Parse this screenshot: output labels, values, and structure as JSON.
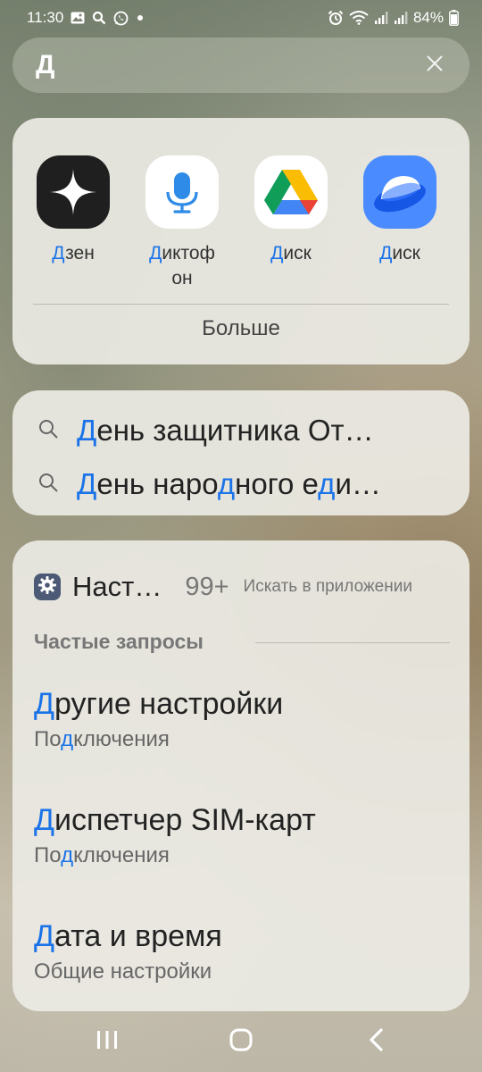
{
  "status_bar": {
    "time": "11:30",
    "battery": "84%",
    "left_icons": [
      "gallery-icon",
      "search-icon",
      "whatsapp-icon",
      "dot-icon"
    ],
    "right_icons": [
      "alarm-icon",
      "wifi-icon",
      "signal-icon",
      "signal-icon",
      "battery-icon"
    ]
  },
  "search": {
    "query": "Д",
    "clear_icon": "close-icon"
  },
  "apps": {
    "items": [
      {
        "label_hl": "Д",
        "label_rest": "зен",
        "icon": "dzen-icon",
        "bg": "#1f1f1f"
      },
      {
        "label_hl": "Д",
        "label_rest": "иктоф он",
        "icon": "microphone-icon",
        "bg": "#ffffff"
      },
      {
        "label_hl": "Д",
        "label_rest": "иск",
        "icon": "google-drive-icon",
        "bg": "#ffffff"
      },
      {
        "label_hl": "Д",
        "label_rest": "иск",
        "icon": "yandex-disk-icon",
        "bg": "#4a8cff"
      }
    ],
    "more_label": "Больше"
  },
  "suggestions": [
    {
      "p1": "Д",
      "p2": "ень защитника От…",
      "p3": "",
      "p4": "",
      "p5": "",
      "p6": ""
    },
    {
      "p1": "Д",
      "p2": "ень наро",
      "p3": "д",
      "p4": "ного е",
      "p5": "д",
      "p6": "и…"
    }
  ],
  "settings": {
    "app_title": "Наст…",
    "count": "99+",
    "search_in_app": "Искать в приложении",
    "section_label": "Частые запросы",
    "results": [
      {
        "hl": "Д",
        "rest": "ругие настройки",
        "sub_a": "По",
        "sub_hl": "д",
        "sub_b": "ключения"
      },
      {
        "hl": "Д",
        "rest": "испетчер SIM-карт",
        "sub_a": "По",
        "sub_hl": "д",
        "sub_b": "ключения"
      },
      {
        "hl": "Д",
        "rest": "ата и время",
        "sub_a": "Общие настройки",
        "sub_hl": "",
        "sub_b": ""
      }
    ]
  },
  "colors": {
    "highlight": "#1a73e8",
    "settings_badge": "#4c5a75"
  },
  "navbar": {
    "icons": [
      "recent-apps-icon",
      "home-icon",
      "back-icon"
    ]
  }
}
